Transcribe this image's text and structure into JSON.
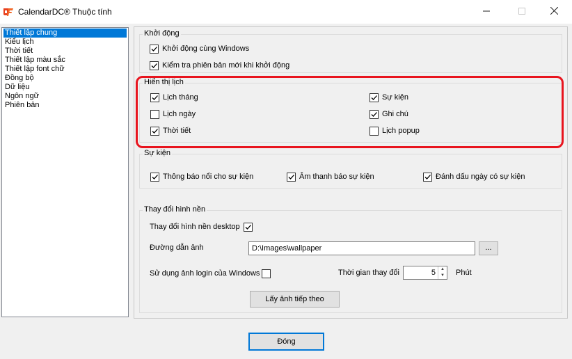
{
  "window": {
    "title": "CalendarDC® Thuộc tính",
    "minimize_icon": "minimize-icon",
    "maximize_icon": "maximize-icon",
    "close_icon": "close-icon",
    "app_icon_color": "#e8401e"
  },
  "sidebar": {
    "items": [
      {
        "label": "Thiết lập chung",
        "selected": true
      },
      {
        "label": "Kiểu lịch"
      },
      {
        "label": "Thời tiết"
      },
      {
        "label": "Thiết lập màu sắc"
      },
      {
        "label": "Thiết lập font chữ"
      },
      {
        "label": "Đồng bộ"
      },
      {
        "label": "Dữ liệu"
      },
      {
        "label": "Ngôn ngữ"
      },
      {
        "label": "Phiên bản"
      }
    ]
  },
  "startup": {
    "title": "Khởi động",
    "options": [
      {
        "label": "Khởi động cùng Windows",
        "checked": true
      },
      {
        "label": "Kiểm tra phiên bản mới khi khởi động",
        "checked": true
      }
    ]
  },
  "display": {
    "title": "Hiển thị lịch",
    "options": [
      {
        "label": "Lịch tháng",
        "checked": true
      },
      {
        "label": "Lịch ngày",
        "checked": false
      },
      {
        "label": "Thời tiết",
        "checked": true
      },
      {
        "label": "Sự kiện",
        "checked": true
      },
      {
        "label": "Ghi chú",
        "checked": true
      },
      {
        "label": "Lịch popup",
        "checked": false
      }
    ],
    "highlight_color": "#e8141e"
  },
  "events": {
    "title": "Sự kiện",
    "options": [
      {
        "label": "Thông báo nổi cho sự kiện",
        "checked": true
      },
      {
        "label": "Âm thanh báo sự kiện",
        "checked": true
      },
      {
        "label": "Đánh dấu ngày có sự kiện",
        "checked": true
      }
    ]
  },
  "wallpaper": {
    "title": "Thay đổi hình nền",
    "change_desktop_label": "Thay đổi hình nền desktop",
    "change_desktop_checked": true,
    "path_label": "Đường dẫn ảnh",
    "path_value": "D:\\Images\\wallpaper",
    "browse_label": "...",
    "use_login_label": "Sử dụng ảnh login của Windows",
    "use_login_checked": false,
    "interval_label": "Thời gian thay đổi",
    "interval_value": "5",
    "interval_unit": "Phút",
    "next_button": "Lấy ảnh tiếp theo"
  },
  "footer": {
    "close_button": "Đóng"
  }
}
